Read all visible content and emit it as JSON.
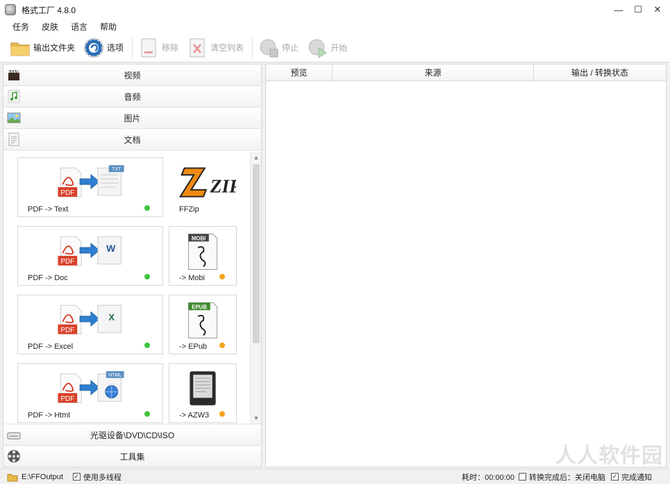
{
  "window": {
    "title": "格式工厂 4.8.0",
    "minimize": "—",
    "maximize": "☐",
    "close": "✕"
  },
  "menu": [
    "任务",
    "皮肤",
    "语言",
    "帮助"
  ],
  "toolbar": {
    "output_folder": "输出文件夹",
    "options": "选项",
    "remove": "移除",
    "clear_list": "清空列表",
    "stop": "停止",
    "start": "开始"
  },
  "categories": {
    "video": "视频",
    "audio": "音频",
    "image": "图片",
    "document": "文档"
  },
  "tiles": [
    {
      "label": "PDF -> Text",
      "badge": "TXT",
      "status": "green"
    },
    {
      "label": "FFZip",
      "badge": "ZIP",
      "status": ""
    },
    {
      "label": "PDF -> Doc",
      "badge": "W",
      "status": "green"
    },
    {
      "label": "-> Mobi",
      "badge": "MOBI",
      "status": "orange"
    },
    {
      "label": "PDF -> Excel",
      "badge": "X",
      "status": "green"
    },
    {
      "label": "-> EPub",
      "badge": "EPUB",
      "status": "orange"
    },
    {
      "label": "PDF -> Html",
      "badge": "HTML",
      "status": "green"
    },
    {
      "label": "-> AZW3",
      "badge": "",
      "status": "orange"
    }
  ],
  "bottom_categories": {
    "rom": "光驱设备\\DVD\\CD\\ISO",
    "tools": "工具集"
  },
  "task_table": {
    "columns": [
      "预览",
      "来源",
      "输出 / 转换状态"
    ]
  },
  "statusbar": {
    "output_path": "E:\\FFOutput",
    "multithread": "使用多线程",
    "elapsed": "耗时：00:00:00",
    "after_convert": "转换完成后：关闭电脑",
    "notify": "完成通知"
  },
  "watermark": "人人软件园",
  "colors": {
    "green": "#3cc43c",
    "orange": "#f3a21a",
    "pdf_red": "#d9422b",
    "arrow_blue": "#2f7fd0"
  }
}
